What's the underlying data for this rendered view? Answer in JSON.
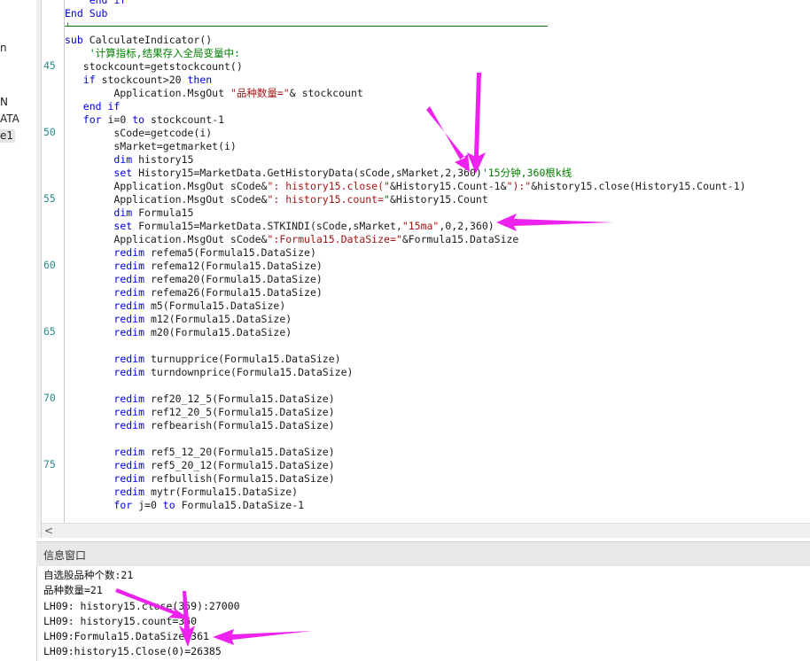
{
  "sidebar": {
    "items": [
      {
        "label": "n"
      },
      {
        "label": "N"
      },
      {
        "label": "ATA"
      },
      {
        "label": "e1"
      }
    ]
  },
  "gutter": {
    "line_numbers": [
      "45",
      "50",
      "55",
      "60",
      "65",
      "70",
      "75"
    ]
  },
  "code": {
    "lines": [
      {
        "parts": [
          {
            "t": "    end if",
            "c": "kw"
          }
        ]
      },
      {
        "parts": [
          {
            "t": "End Sub",
            "c": "kw"
          }
        ]
      },
      {
        "parts": [
          {
            "t": "'",
            "c": "cm"
          }
        ]
      },
      {
        "parts": [
          {
            "t": "sub ",
            "c": "kw"
          },
          {
            "t": "CalculateIndicator()",
            "c": ""
          }
        ]
      },
      {
        "parts": [
          {
            "t": "    '计算指标,结果存入全局变量中:",
            "c": "cm"
          }
        ]
      },
      {
        "parts": [
          {
            "t": "   stockcount=getstockcount()",
            "c": ""
          }
        ]
      },
      {
        "parts": [
          {
            "t": "   ",
            "c": ""
          },
          {
            "t": "if ",
            "c": "kw"
          },
          {
            "t": "stockcount>20 ",
            "c": ""
          },
          {
            "t": "then",
            "c": "kw"
          }
        ]
      },
      {
        "parts": [
          {
            "t": "        Application.MsgOut ",
            "c": ""
          },
          {
            "t": "\"品种数量=\"",
            "c": "st"
          },
          {
            "t": "& stockcount",
            "c": ""
          }
        ]
      },
      {
        "parts": [
          {
            "t": "   ",
            "c": ""
          },
          {
            "t": "end if",
            "c": "kw"
          }
        ]
      },
      {
        "parts": [
          {
            "t": "   ",
            "c": ""
          },
          {
            "t": "for ",
            "c": "kw"
          },
          {
            "t": "i=0 ",
            "c": ""
          },
          {
            "t": "to ",
            "c": "kw"
          },
          {
            "t": "stockcount-1",
            "c": ""
          }
        ]
      },
      {
        "parts": [
          {
            "t": "        sCode=getcode(i)",
            "c": ""
          }
        ]
      },
      {
        "parts": [
          {
            "t": "        sMarket=getmarket(i)",
            "c": ""
          }
        ]
      },
      {
        "parts": [
          {
            "t": "        ",
            "c": ""
          },
          {
            "t": "dim ",
            "c": "kw"
          },
          {
            "t": "history15",
            "c": ""
          }
        ]
      },
      {
        "parts": [
          {
            "t": "        ",
            "c": ""
          },
          {
            "t": "set ",
            "c": "kw"
          },
          {
            "t": "History15=MarketData.GetHistoryData(sCode,sMarket,2,360)",
            "c": ""
          },
          {
            "t": "'15分钟,360根k线",
            "c": "cm"
          }
        ]
      },
      {
        "parts": [
          {
            "t": "        Application.MsgOut sCode&",
            "c": ""
          },
          {
            "t": "\": history15.close(\"",
            "c": "st"
          },
          {
            "t": "&History15.Count-1&",
            "c": ""
          },
          {
            "t": "\"):\"",
            "c": "st"
          },
          {
            "t": "&history15.close(History15.Count-1)",
            "c": ""
          }
        ]
      },
      {
        "parts": [
          {
            "t": "        Application.MsgOut sCode&",
            "c": ""
          },
          {
            "t": "\": history15.count=\"",
            "c": "st"
          },
          {
            "t": "&History15.Count",
            "c": ""
          }
        ]
      },
      {
        "parts": [
          {
            "t": "        ",
            "c": ""
          },
          {
            "t": "dim ",
            "c": "kw"
          },
          {
            "t": "Formula15",
            "c": ""
          }
        ]
      },
      {
        "parts": [
          {
            "t": "        ",
            "c": ""
          },
          {
            "t": "set ",
            "c": "kw"
          },
          {
            "t": "Formula15=MarketData.STKINDI(sCode,sMarket,",
            "c": ""
          },
          {
            "t": "\"15ma\"",
            "c": "st"
          },
          {
            "t": ",0,2,360)",
            "c": ""
          }
        ]
      },
      {
        "parts": [
          {
            "t": "        Application.MsgOut sCode&",
            "c": ""
          },
          {
            "t": "\":Formula15.DataSize=\"",
            "c": "st"
          },
          {
            "t": "&Formula15.DataSize",
            "c": ""
          }
        ]
      },
      {
        "parts": [
          {
            "t": "        ",
            "c": ""
          },
          {
            "t": "redim ",
            "c": "kw"
          },
          {
            "t": "refema5(Formula15.DataSize)",
            "c": ""
          }
        ]
      },
      {
        "parts": [
          {
            "t": "        ",
            "c": ""
          },
          {
            "t": "redim ",
            "c": "kw"
          },
          {
            "t": "refema12(Formula15.DataSize)",
            "c": ""
          }
        ]
      },
      {
        "parts": [
          {
            "t": "        ",
            "c": ""
          },
          {
            "t": "redim ",
            "c": "kw"
          },
          {
            "t": "refema20(Formula15.DataSize)",
            "c": ""
          }
        ]
      },
      {
        "parts": [
          {
            "t": "        ",
            "c": ""
          },
          {
            "t": "redim ",
            "c": "kw"
          },
          {
            "t": "refema26(Formula15.DataSize)",
            "c": ""
          }
        ]
      },
      {
        "parts": [
          {
            "t": "        ",
            "c": ""
          },
          {
            "t": "redim ",
            "c": "kw"
          },
          {
            "t": "m5(Formula15.DataSize)",
            "c": ""
          }
        ]
      },
      {
        "parts": [
          {
            "t": "        ",
            "c": ""
          },
          {
            "t": "redim ",
            "c": "kw"
          },
          {
            "t": "m12(Formula15.DataSize)",
            "c": ""
          }
        ]
      },
      {
        "parts": [
          {
            "t": "        ",
            "c": ""
          },
          {
            "t": "redim ",
            "c": "kw"
          },
          {
            "t": "m20(Formula15.DataSize)",
            "c": ""
          }
        ]
      },
      {
        "parts": [
          {
            "t": "",
            "c": ""
          }
        ]
      },
      {
        "parts": [
          {
            "t": "        ",
            "c": ""
          },
          {
            "t": "redim ",
            "c": "kw"
          },
          {
            "t": "turnupprice(Formula15.DataSize)",
            "c": ""
          }
        ]
      },
      {
        "parts": [
          {
            "t": "        ",
            "c": ""
          },
          {
            "t": "redim ",
            "c": "kw"
          },
          {
            "t": "turndownprice(Formula15.DataSize)",
            "c": ""
          }
        ]
      },
      {
        "parts": [
          {
            "t": "",
            "c": ""
          }
        ]
      },
      {
        "parts": [
          {
            "t": "        ",
            "c": ""
          },
          {
            "t": "redim ",
            "c": "kw"
          },
          {
            "t": "ref20_12_5(Formula15.DataSize)",
            "c": ""
          }
        ]
      },
      {
        "parts": [
          {
            "t": "        ",
            "c": ""
          },
          {
            "t": "redim ",
            "c": "kw"
          },
          {
            "t": "ref12_20_5(Formula15.DataSize)",
            "c": ""
          }
        ]
      },
      {
        "parts": [
          {
            "t": "        ",
            "c": ""
          },
          {
            "t": "redim ",
            "c": "kw"
          },
          {
            "t": "refbearish(Formula15.DataSize)",
            "c": ""
          }
        ]
      },
      {
        "parts": [
          {
            "t": "",
            "c": ""
          }
        ]
      },
      {
        "parts": [
          {
            "t": "        ",
            "c": ""
          },
          {
            "t": "redim ",
            "c": "kw"
          },
          {
            "t": "ref5_12_20(Formula15.DataSize)",
            "c": ""
          }
        ]
      },
      {
        "parts": [
          {
            "t": "        ",
            "c": ""
          },
          {
            "t": "redim ",
            "c": "kw"
          },
          {
            "t": "ref5_20_12(Formula15.DataSize)",
            "c": ""
          }
        ]
      },
      {
        "parts": [
          {
            "t": "        ",
            "c": ""
          },
          {
            "t": "redim ",
            "c": "kw"
          },
          {
            "t": "refbullish(Formula15.DataSize)",
            "c": ""
          }
        ]
      },
      {
        "parts": [
          {
            "t": "        ",
            "c": ""
          },
          {
            "t": "redim ",
            "c": "kw"
          },
          {
            "t": "mytr(Formula15.DataSize)",
            "c": ""
          }
        ]
      },
      {
        "parts": [
          {
            "t": "        ",
            "c": ""
          },
          {
            "t": "for ",
            "c": "kw"
          },
          {
            "t": "j=0 ",
            "c": ""
          },
          {
            "t": "to ",
            "c": "kw"
          },
          {
            "t": "Formula15.DataSize-1",
            "c": ""
          }
        ]
      }
    ]
  },
  "scrollbar": {
    "left_arrow": "<"
  },
  "panel": {
    "title": "信息窗口",
    "output_lines": [
      "自选股品种个数:21",
      "品种数量=21",
      "LH09: history15.close(359):27000",
      "LH09: history15.count=360",
      "LH09:Formula15.DataSize=361",
      "LH09:history15.Close(0)=26385"
    ]
  },
  "colors": {
    "keyword": "#0000dd",
    "comment": "#008000",
    "string": "#a31515",
    "annotation_arrow": "#ee22ee"
  }
}
